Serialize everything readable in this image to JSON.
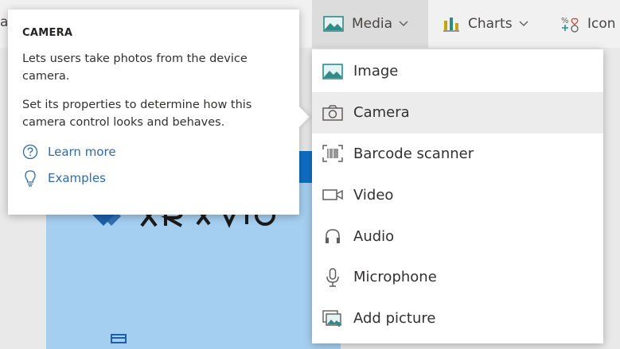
{
  "ribbon": {
    "left_fragment": "al",
    "media": {
      "label": "Media",
      "icon": "image-icon"
    },
    "charts": {
      "label": "Charts",
      "icon": "bar-chart-icon"
    },
    "icons": {
      "label": "Icon",
      "icon": "shapes-icon"
    }
  },
  "tooltip": {
    "title": "CAMERA",
    "description": "Lets users take photos from the device camera.",
    "details": "Set its properties to determine how this camera control looks and behaves.",
    "learn_more": "Learn more",
    "examples": "Examples"
  },
  "menu": {
    "items": [
      {
        "label": "Image",
        "icon": "image-icon"
      },
      {
        "label": "Camera",
        "icon": "camera-icon",
        "highlighted": true
      },
      {
        "label": "Barcode scanner",
        "icon": "barcode-icon"
      },
      {
        "label": "Video",
        "icon": "video-icon"
      },
      {
        "label": "Audio",
        "icon": "headphones-icon"
      },
      {
        "label": "Microphone",
        "icon": "microphone-icon"
      },
      {
        "label": "Add picture",
        "icon": "add-picture-icon"
      }
    ]
  },
  "colors": {
    "ribbon_bg": "#f1f1f1",
    "active_tab": "#dcdcdc",
    "link": "#2f6ba8",
    "icon_teal": "#2e8b87",
    "chart_gold": "#c8a400",
    "canvas_blue": "#a5cff0",
    "brand_blue": "#0f6fc6"
  }
}
